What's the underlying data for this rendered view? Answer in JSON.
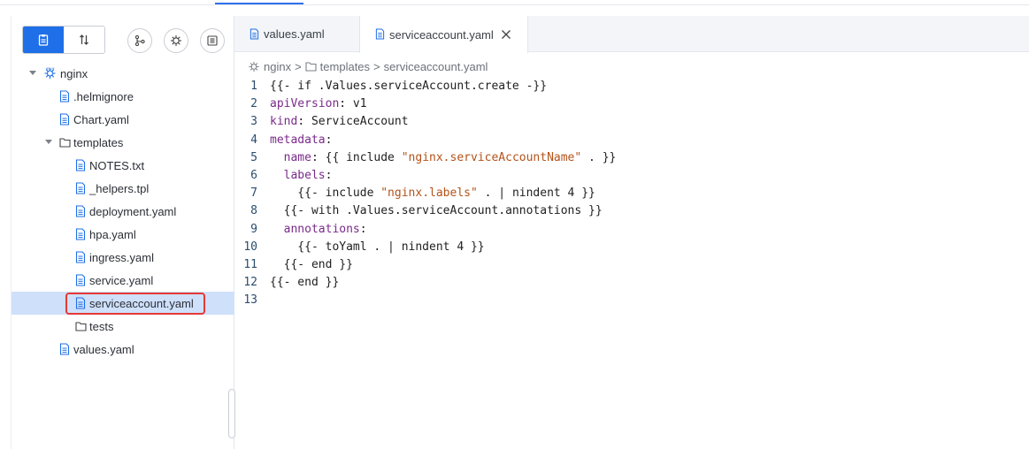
{
  "sidebar": {
    "tree": [
      {
        "label": "nginx",
        "level": 0,
        "type": "helm",
        "caret": "expanded"
      },
      {
        "label": ".helmignore",
        "level": 1,
        "type": "file"
      },
      {
        "label": "Chart.yaml",
        "level": 1,
        "type": "file"
      },
      {
        "label": "templates",
        "level": 1,
        "type": "folder",
        "caret": "expanded"
      },
      {
        "label": "NOTES.txt",
        "level": 2,
        "type": "file"
      },
      {
        "label": "_helpers.tpl",
        "level": 2,
        "type": "file"
      },
      {
        "label": "deployment.yaml",
        "level": 2,
        "type": "file"
      },
      {
        "label": "hpa.yaml",
        "level": 2,
        "type": "file"
      },
      {
        "label": "ingress.yaml",
        "level": 2,
        "type": "file"
      },
      {
        "label": "service.yaml",
        "level": 2,
        "type": "file"
      },
      {
        "label": "serviceaccount.yaml",
        "level": 2,
        "type": "file",
        "selected": true,
        "highlighted": true
      },
      {
        "label": "tests",
        "level": 2,
        "type": "folder"
      },
      {
        "label": "values.yaml",
        "level": 1,
        "type": "file"
      }
    ],
    "toolbar": {
      "segments": [
        "clipboard-icon",
        "sort-icon"
      ],
      "round_buttons": [
        "git-branch-icon",
        "helm-icon",
        "archive-icon"
      ],
      "accent": "#1f6fe8"
    }
  },
  "editor": {
    "tabs": [
      {
        "label": "values.yaml",
        "active": false
      },
      {
        "label": "serviceaccount.yaml",
        "active": true,
        "closable": true
      }
    ],
    "breadcrumb": [
      "nginx",
      ">",
      "templates",
      ">",
      "serviceaccount.yaml"
    ],
    "lines": [
      {
        "n": "1",
        "text": "{{- if .Values.serviceAccount.create -}}"
      },
      {
        "n": "2",
        "text": "apiVersion: v1"
      },
      {
        "n": "3",
        "text": "kind: ServiceAccount"
      },
      {
        "n": "4",
        "text": "metadata:"
      },
      {
        "n": "5",
        "text": "  name: {{ include \"nginx.serviceAccountName\" . }}"
      },
      {
        "n": "6",
        "text": "  labels:"
      },
      {
        "n": "7",
        "text": "    {{- include \"nginx.labels\" . | nindent 4 }}"
      },
      {
        "n": "8",
        "text": "  {{- with .Values.serviceAccount.annotations }}"
      },
      {
        "n": "9",
        "text": "  annotations:"
      },
      {
        "n": "10",
        "text": "    {{- toYaml . | nindent 4 }}"
      },
      {
        "n": "11",
        "text": "  {{- end }}"
      },
      {
        "n": "12",
        "text": "{{- end }}"
      },
      {
        "n": "13",
        "text": ""
      }
    ]
  },
  "colors": {
    "selection": "#cfe0fb",
    "highlight_border": "#e53935",
    "yaml_key": "#7a2a8a",
    "yaml_string": "#b4531a"
  }
}
